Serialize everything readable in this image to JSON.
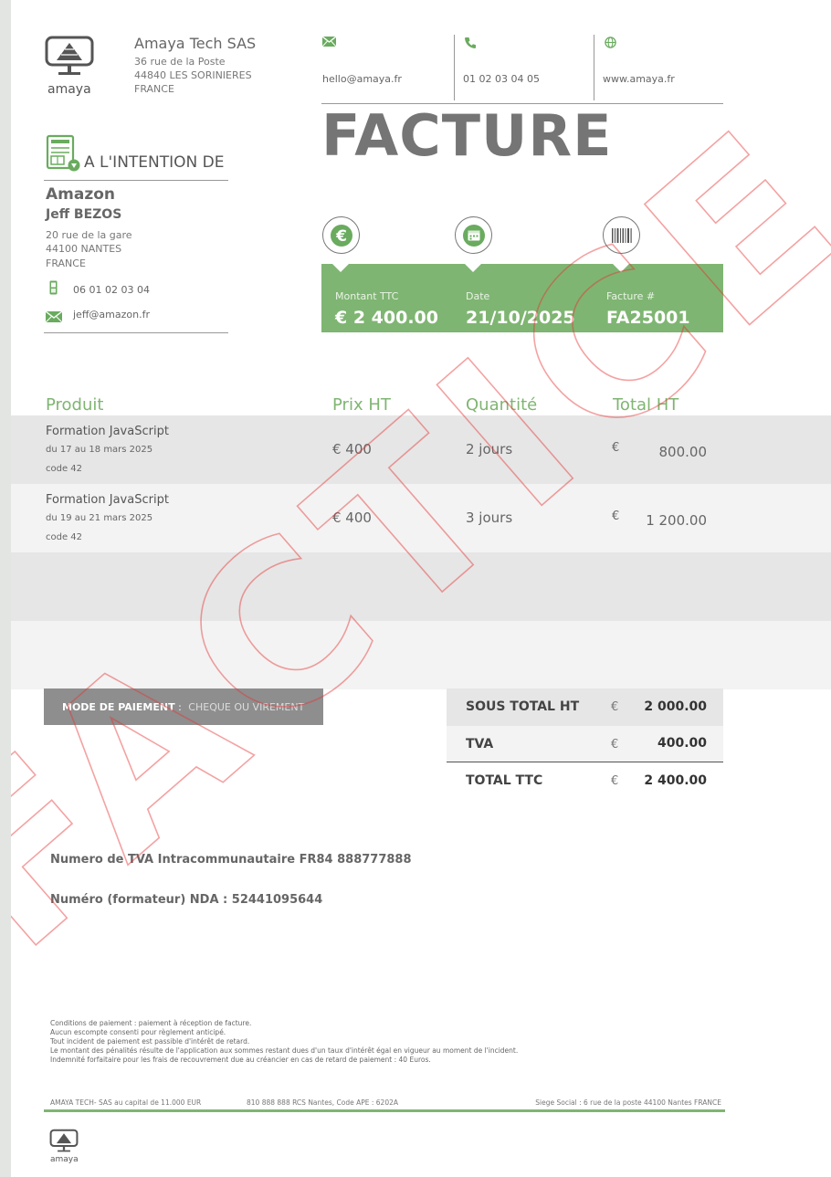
{
  "company": {
    "logo_text": "amaya",
    "name": "Amaya Tech SAS",
    "address_lines": [
      "36 rue de la Poste",
      "44840 LES SORINIERES",
      "FRANCE"
    ]
  },
  "contacts": {
    "email": "hello@amaya.fr",
    "phone": "01 02 03 04 05",
    "website": "www.amaya.fr"
  },
  "document_title": "FACTURE",
  "recipient": {
    "heading": "A L'INTENTION DE",
    "company": "Amazon",
    "name": "Jeff BEZOS",
    "address_lines": [
      "20 rue de la gare",
      "44100 NANTES",
      "FRANCE"
    ],
    "phone": "06 01 02 03 04",
    "email": "jeff@amazon.fr"
  },
  "summary": {
    "amount_label": "Montant TTC",
    "amount_value": "€ 2 400.00",
    "date_label": "Date",
    "date_value": "21/10/2025",
    "invoice_label": "Facture #",
    "invoice_value": "FA25001"
  },
  "table": {
    "headers": [
      "Produit",
      "Prix HT",
      "Quantité",
      "Total HT"
    ],
    "rows": [
      {
        "title": "Formation JavaScript",
        "dates": "du 17 au 18 mars 2025",
        "code": "code 42",
        "price": "€  400",
        "quantity": "2 jours",
        "currency": "€",
        "total": "800.00"
      },
      {
        "title": "Formation JavaScript",
        "dates": "du 19 au 21 mars 2025",
        "code": "code 42",
        "price": "€  400",
        "quantity": "3 jours",
        "currency": "€",
        "total": "1 200.00"
      }
    ]
  },
  "payment": {
    "label": "MODE DE PAIEMENT",
    "separator": " : ",
    "value": "CHEQUE OU VIREMENT"
  },
  "totals": {
    "currency": "€",
    "subtotal_label": "SOUS TOTAL HT",
    "subtotal_value": "2 000.00",
    "tva_label": "TVA",
    "tva_value": "400.00",
    "total_label": "TOTAL TTC",
    "total_value": "2 400.00"
  },
  "legal": {
    "tva_number": "Numero de TVA Intracommunautaire FR84 888777888",
    "nda": "Numéro (formateur) NDA : 52441095644"
  },
  "conditions": [
    "Conditions de paiement : paiement à réception de facture.",
    "Aucun escompte consenti pour règlement anticipé.",
    "Tout incident de paiement est passible d'intérêt de retard.",
    "Le montant des pénalités résulte de l'application aux sommes restant dues d'un taux d'intérêt égal en vigueur au moment de l'incident.",
    "Indemnité forfaitaire pour les frais de recouvrement due au créancier en cas de retard de paiement : 40 Euros."
  ],
  "footer": {
    "capital": "AMAYA TECH- SAS au capital de 11.000 EUR",
    "rcs": "810 888 888 RCS Nantes, Code APE :  6202A",
    "siege": "Siege Social : 6 rue de la poste 44100 Nantes FRANCE",
    "logo_text": "amaya"
  },
  "watermark": {
    "text": "FACTICE",
    "color": "#e63030"
  },
  "colors": {
    "accent_green": "#7fb572",
    "title_gray": "#757575"
  }
}
